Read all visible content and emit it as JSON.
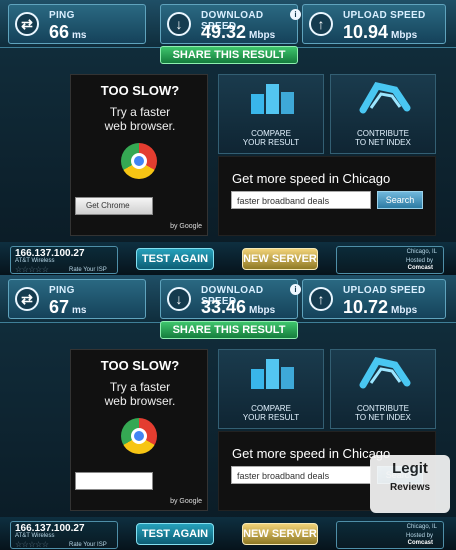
{
  "results": [
    {
      "ping_label": "PING",
      "ping_value": "66",
      "ping_unit": "ms",
      "download_label": "DOWNLOAD SPEED",
      "download_value": "49.32",
      "download_unit": "Mbps",
      "upload_label": "UPLOAD SPEED",
      "upload_value": "10.94",
      "upload_unit": "Mbps",
      "share": "SHARE THIS RESULT",
      "ad_title": "TOO SLOW?",
      "ad_text1": "Try a faster",
      "ad_text2": "web browser.",
      "ad_button": "Get Chrome",
      "ad_by": "by Google",
      "compare": "COMPARE\nYOUR RESULT",
      "contribute": "CONTRIBUTE\nTO NET INDEX",
      "search_title": "Get more speed in Chicago",
      "search_value": "faster broadband deals",
      "search_button": "Search",
      "ip": "166.137.100.27",
      "isp": "AT&T Wireless",
      "rate": "Rate Your ISP",
      "test_again": "TEST AGAIN",
      "new_server": "NEW SERVER",
      "city": "Chicago, IL",
      "hosted_by": "Hosted by",
      "host": "Comcast"
    },
    {
      "ping_label": "PING",
      "ping_value": "67",
      "ping_unit": "ms",
      "download_label": "DOWNLOAD SPEED",
      "download_value": "33.46",
      "download_unit": "Mbps",
      "upload_label": "UPLOAD SPEED",
      "upload_value": "10.72",
      "upload_unit": "Mbps",
      "share": "SHARE THIS RESULT",
      "ad_title": "TOO SLOW?",
      "ad_text1": "Try a faster",
      "ad_text2": "web browser.",
      "ad_button": "",
      "ad_by": "by Google",
      "compare": "COMPARE\nYOUR RESULT",
      "contribute": "CONTRIBUTE\nTO NET INDEX",
      "search_title": "Get more speed in Chicago",
      "search_value": "faster broadband deals",
      "search_button": "Search",
      "ip": "166.137.100.27",
      "isp": "AT&T Wireless",
      "rate": "Rate Your ISP",
      "test_again": "TEST AGAIN",
      "new_server": "NEW SERVER",
      "city": "Chicago, IL",
      "hosted_by": "Hosted by",
      "host": "Comcast"
    }
  ],
  "colors": {
    "accent": "#157d3d",
    "stat": "#2a6982",
    "brand": "#f1d277"
  },
  "icons": {
    "ping": "swap-icon",
    "download": "download-arrow-icon",
    "upload": "upload-arrow-icon",
    "info": "info-icon"
  }
}
